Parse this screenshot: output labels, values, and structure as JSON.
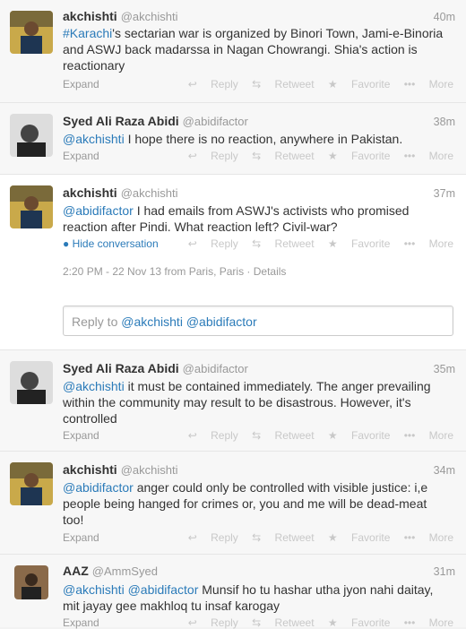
{
  "actions": {
    "reply": "Reply",
    "retweet": "Retweet",
    "favorite": "Favorite",
    "more": "More",
    "expand": "Expand"
  },
  "tweets": [
    {
      "name": "akchishti",
      "handle": "@akchishti",
      "time": "40m",
      "hashtag": "#Karachi",
      "text": "'s sectarian war is organized by Binori Town, Jami-e-Binoria and ASWJ back madarssa in Nagan Chowrangi. Shia's action is reactionary"
    },
    {
      "name": "Syed Ali Raza Abidi",
      "handle": "@abidifactor",
      "time": "38m",
      "mention": "@akchishti",
      "text": " I hope there is no reaction, anywhere in Pakistan."
    },
    {
      "name": "akchishti",
      "handle": "@akchishti",
      "time": "37m",
      "mention": "@abidifactor",
      "text": " I had emails from ASWJ's activists who promised reaction after Pindi. What reaction left? Civil-war?",
      "hide": "Hide conversation",
      "meta": "2:20 PM - 22 Nov 13 from Paris, Paris · Details"
    },
    {
      "name": "Syed Ali Raza Abidi",
      "handle": "@abidifactor",
      "time": "35m",
      "mention": "@akchishti",
      "text": " it must be contained immediately. The anger prevailing within the community may result to be disastrous. However, it's controlled"
    },
    {
      "name": "akchishti",
      "handle": "@akchishti",
      "time": "34m",
      "mention": "@abidifactor",
      "text": " anger could only be controlled with visible justice: i,e people being hanged for crimes or, you and me will be dead-meat too!"
    },
    {
      "name": "AAZ",
      "handle": "@AmmSyed",
      "time": "31m",
      "mention": "@akchishti @abidifactor",
      "text": " Munsif ho tu hashar utha jyon nahi daitay, mit jayay gee makhloq tu insaf karogay"
    }
  ],
  "reply_box": {
    "prefix": "Reply to ",
    "mentions": "@akchishti @abidifactor"
  }
}
